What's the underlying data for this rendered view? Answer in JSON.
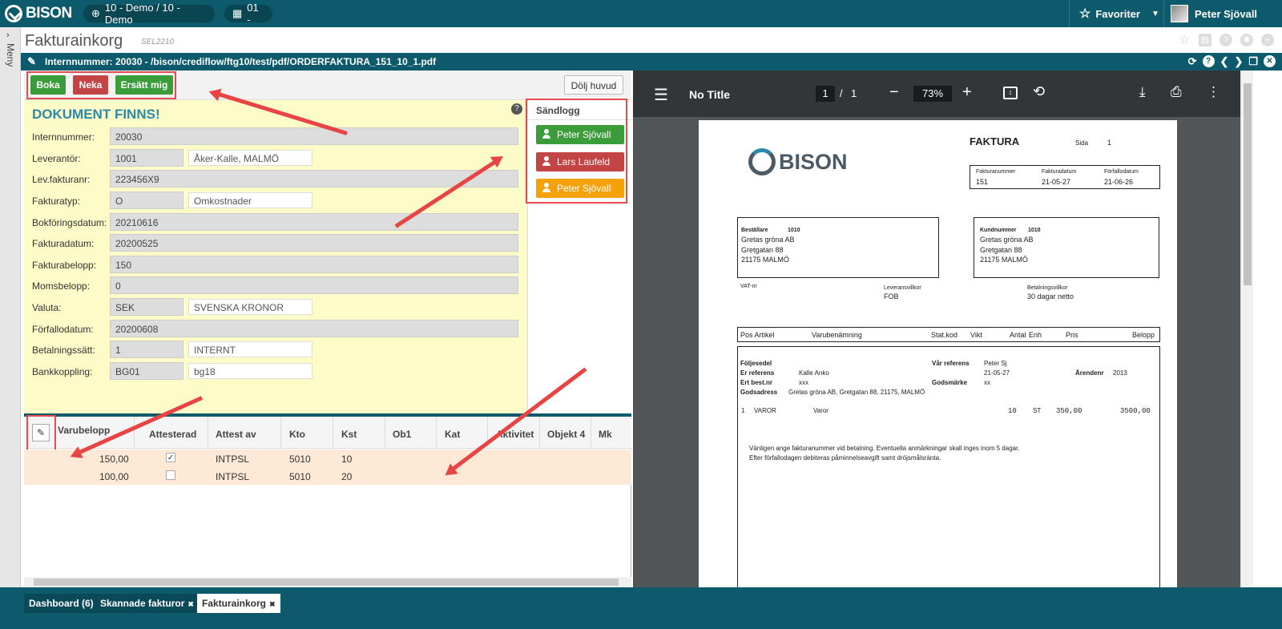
{
  "topbar": {
    "brand": "BISON",
    "company": "10 - Demo / 10 - Demo",
    "unit": "01 -",
    "favorites": "Favoriter",
    "user": "Peter Sjövall"
  },
  "sidebar": {
    "label": "Meny"
  },
  "page": {
    "title": "Fakturainkorg",
    "code": "SEL2210"
  },
  "pathbar": {
    "text": "Internnummer: 20030 - /bison/crediflow/ftg10/test/pdf/ORDERFAKTURA_151_10_1.pdf"
  },
  "actions": {
    "boka": "Boka",
    "neka": "Neka",
    "ersatt": "Ersätt mig",
    "dolj": "Dölj huvud"
  },
  "form": {
    "title": "DOKUMENT FINNS!",
    "rows": [
      {
        "label": "Internnummer:",
        "value": "20030",
        "desc": ""
      },
      {
        "label": "Leverantör:",
        "value": "1001",
        "desc": "Åker-Kalle, MALMÖ"
      },
      {
        "label": "Lev.fakturanr:",
        "value": "223456X9",
        "desc": ""
      },
      {
        "label": "Fakturatyp:",
        "value": "O",
        "desc": "Omkostnader"
      },
      {
        "label": "Bokföringsdatum:",
        "value": "20210616",
        "desc": ""
      },
      {
        "label": "Fakturadatum:",
        "value": "20200525",
        "desc": ""
      },
      {
        "label": "Fakturabelopp:",
        "value": "150",
        "desc": ""
      },
      {
        "label": "Momsbelopp:",
        "value": "0",
        "desc": ""
      },
      {
        "label": "Valuta:",
        "value": "SEK",
        "desc": "SVENSKA KRONOR"
      },
      {
        "label": "Förfallodatum:",
        "value": "20200608",
        "desc": ""
      },
      {
        "label": "Betalningssätt:",
        "value": "1",
        "desc": "INTERNT"
      },
      {
        "label": "Bankkoppling:",
        "value": "BG01",
        "desc": "bg18"
      }
    ]
  },
  "sandlogg": {
    "title": "Sändlogg",
    "items": [
      {
        "name": "Peter Sjövall",
        "color": "#3a9d3a"
      },
      {
        "name": "Lars Laufeld",
        "color": "#c34444"
      },
      {
        "name": "Peter Sjövall",
        "color": "#f5a20a"
      }
    ]
  },
  "grid": {
    "headers": [
      "Varubelopp",
      "Attesterad",
      "Attest av",
      "Kto",
      "Kst",
      "Ob1",
      "Kat",
      "Aktivitet",
      "Objekt 4",
      "Mk"
    ],
    "rows": [
      {
        "belopp": "150,00",
        "attesterad": true,
        "attestav": "INTPSL",
        "kto": "5010",
        "kst": "10"
      },
      {
        "belopp": "100,00",
        "attesterad": false,
        "attestav": "INTPSL",
        "kto": "5010",
        "kst": "20"
      }
    ]
  },
  "pdfviewer": {
    "title": "No Title",
    "page": "1",
    "pages": "1",
    "zoom": "73%"
  },
  "invoice": {
    "heading": "FAKTURA",
    "sida_label": "Sida",
    "sida": "1",
    "logo": "BISON",
    "fakturanummer_label": "Fakturanummer",
    "fakturanummer": "151",
    "fakturadatum_label": "Fakturadatum",
    "fakturadatum": "21-05-27",
    "forfallodatum_label": "Förfallodatum",
    "forfallodatum": "21-06-26",
    "bestallare_label": "Beställare",
    "bestallare_nr": "1010",
    "kundnummer_label": "Kundnummer",
    "kundnummer": "1010",
    "addr1": "Gretas gröna AB",
    "addr2": "Gretgatan 88",
    "addr3": "21175 MALMÖ",
    "vat_label": "VAT-nr",
    "lev_label": "Leveransvillkor",
    "lev": "FOB",
    "bet_label": "Betalningsvillkor",
    "bet": "30 dagar netto",
    "cols": [
      "Pos Artikel",
      "Varubenämning",
      "Stat.kod",
      "Vikt",
      "Antal",
      "Enh",
      "Pris",
      "Belopp"
    ],
    "foljesedel": "Följesedel",
    "er_ref_label": "Er referens",
    "er_ref": "Kalle Anko",
    "ert_best_label": "Ert best.nr",
    "ert_best": "xxx",
    "gods_label": "Godsadress",
    "gods": "Gretas gröna AB, Gretgatan 88, 21175, MALMÖ",
    "var_ref_label": "Vår referens",
    "var_ref": "Peter Sj",
    "var_ref_date": "21-05-27",
    "arende_label": "Ärendenr",
    "arende": "2013",
    "godsmarke_label": "Godsmärke",
    "godsmarke": "xx",
    "line": {
      "pos": "1",
      "art": "VAROR",
      "ben": "Varor",
      "antal": "10",
      "enh": "ST",
      "pris": "350,00",
      "belopp": "3500,00"
    },
    "note1": "Vänligen ange fakturanummer vid betalning. Eventuella anmärkningar skall inges inom 5 dagar.",
    "note2": "Efter förfallodagen debiteras påminnelseavgift samt dröjsmålsränta."
  },
  "tabs": [
    {
      "label": "Dashboard (6)"
    },
    {
      "label": "Skannade fakturor"
    },
    {
      "label": "Fakturainkorg"
    }
  ]
}
